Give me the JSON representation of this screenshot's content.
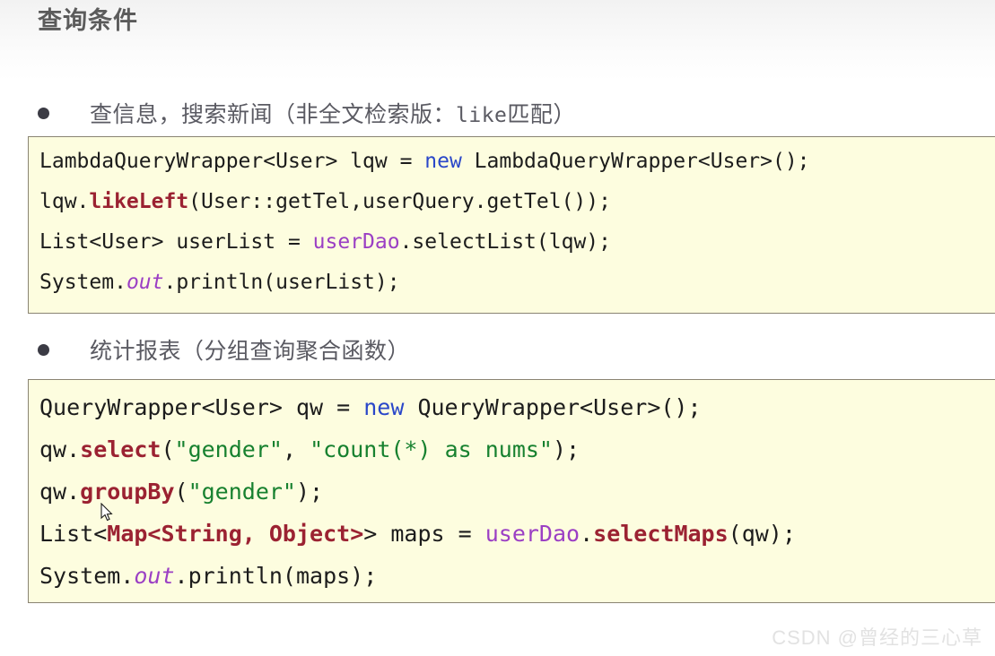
{
  "page": {
    "title": "查询条件",
    "watermark": "CSDN @曾经的三心草"
  },
  "sections": [
    {
      "bullet": {
        "text_before": "查信息，搜索新闻（非全文检索版：",
        "mono_text": "like",
        "text_after": "匹配）"
      },
      "code": {
        "lines": [
          {
            "tokens": [
              {
                "text": "LambdaQueryWrapper<User> lqw = ",
                "style": "plain"
              },
              {
                "text": "new",
                "style": "kw-new"
              },
              {
                "text": " LambdaQueryWrapper<User>();",
                "style": "plain"
              }
            ]
          },
          {
            "tokens": [
              {
                "text": "lqw.",
                "style": "plain"
              },
              {
                "text": "likeLeft",
                "style": "fn-bold"
              },
              {
                "text": "(User::getTel,userQuery.getTel());",
                "style": "plain"
              }
            ]
          },
          {
            "tokens": [
              {
                "text": "List<User> userList = ",
                "style": "plain"
              },
              {
                "text": "userDao",
                "style": "ident-purple"
              },
              {
                "text": ".selectList(lqw);",
                "style": "plain"
              }
            ]
          },
          {
            "tokens": [
              {
                "text": "System.",
                "style": "plain"
              },
              {
                "text": "out",
                "style": "ident-purple-italic"
              },
              {
                "text": ".println(userList);",
                "style": "plain"
              }
            ]
          }
        ]
      }
    },
    {
      "bullet": {
        "text_before": "统计报表（分组查询聚合函数）",
        "mono_text": "",
        "text_after": ""
      },
      "code": {
        "lines": [
          {
            "tokens": [
              {
                "text": "QueryWrapper<User> qw = ",
                "style": "plain"
              },
              {
                "text": "new",
                "style": "kw-new"
              },
              {
                "text": " QueryWrapper<User>();",
                "style": "plain"
              }
            ]
          },
          {
            "tokens": [
              {
                "text": "qw.",
                "style": "plain"
              },
              {
                "text": "select",
                "style": "fn-bold"
              },
              {
                "text": "(",
                "style": "plain"
              },
              {
                "text": "\"gender\"",
                "style": "str-green"
              },
              {
                "text": ", ",
                "style": "plain"
              },
              {
                "text": "\"count(*) as nums\"",
                "style": "str-green"
              },
              {
                "text": ");",
                "style": "plain"
              }
            ]
          },
          {
            "tokens": [
              {
                "text": "qw.",
                "style": "plain"
              },
              {
                "text": "groupBy",
                "style": "fn-bold"
              },
              {
                "text": "(",
                "style": "plain"
              },
              {
                "text": "\"gender\"",
                "style": "str-green"
              },
              {
                "text": ");",
                "style": "plain"
              }
            ]
          },
          {
            "tokens": [
              {
                "text": "List<",
                "style": "plain"
              },
              {
                "text": "Map<String, Object>",
                "style": "type-bold-red"
              },
              {
                "text": "> maps = ",
                "style": "plain"
              },
              {
                "text": "userDao",
                "style": "ident-purple"
              },
              {
                "text": ".",
                "style": "plain"
              },
              {
                "text": "selectMaps",
                "style": "fn-bold"
              },
              {
                "text": "(qw);",
                "style": "plain"
              }
            ]
          },
          {
            "tokens": [
              {
                "text": "System.",
                "style": "plain"
              },
              {
                "text": "out",
                "style": "ident-purple-italic"
              },
              {
                "text": ".println(maps);",
                "style": "plain"
              }
            ]
          }
        ]
      }
    }
  ],
  "colors": {
    "code_background": "#fdfddf",
    "code_border": "#8a8473",
    "keyword": "#2a47c9",
    "method": "#9b2232",
    "identifier": "#9b3fc4",
    "string": "#17812f",
    "title": "#5b5b5b"
  }
}
